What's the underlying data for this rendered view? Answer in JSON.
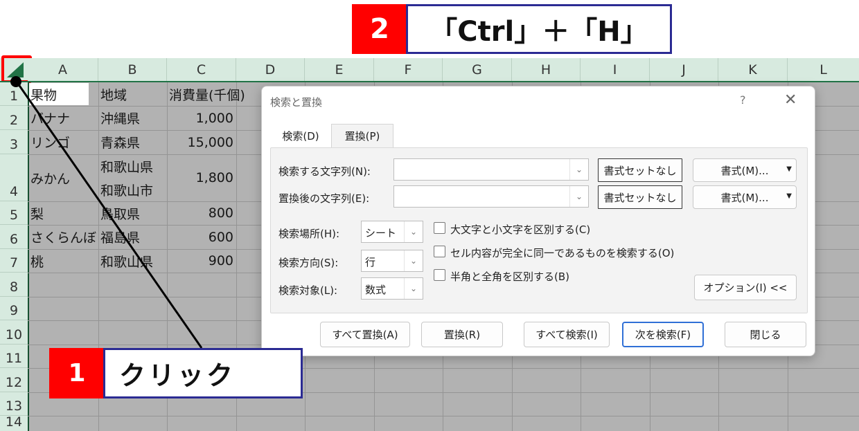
{
  "callout_top": {
    "number": "2",
    "text": "「Ctrl」＋「H」"
  },
  "callout_bottom": {
    "number": "1",
    "text": "クリック"
  },
  "columns": [
    "A",
    "B",
    "C",
    "D",
    "E",
    "F",
    "G",
    "H",
    "I",
    "J",
    "K",
    "L"
  ],
  "rows": [
    "1",
    "2",
    "3",
    "4",
    "5",
    "6",
    "7",
    "8",
    "9",
    "10",
    "11",
    "12",
    "13",
    "14"
  ],
  "cells": {
    "header": [
      "果物",
      "地域",
      "消費量(千個)"
    ],
    "r2": [
      "バナナ",
      "沖縄県",
      "1,000"
    ],
    "r3": [
      "リンゴ",
      "青森県",
      "15,000"
    ],
    "r4": [
      "みかん",
      "和歌山県",
      "和歌山市",
      "1,800"
    ],
    "r5": [
      "梨",
      "鳥取県",
      "800"
    ],
    "r6": [
      "さくらんぼ",
      "福島県",
      "600"
    ],
    "r7": [
      "桃",
      "和歌山県",
      "900"
    ]
  },
  "dialog": {
    "title": "検索と置換",
    "help": "?",
    "close": "✕",
    "tabs": [
      "検索(D)",
      "置換(P)"
    ],
    "find_label": "検索する文字列(N):",
    "find_value": "",
    "replace_label": "置換後の文字列(E):",
    "replace_value": "",
    "no_format": "書式セットなし",
    "format_btn": "書式(M)...",
    "within_label": "検索場所(H):",
    "within_value": "シート",
    "search_label": "検索方向(S):",
    "search_value": "行",
    "lookin_label": "検索対象(L):",
    "lookin_value": "数式",
    "match_case": "大文字と小文字を区別する(C)",
    "match_entire": "セル内容が完全に同一であるものを検索する(O)",
    "match_byte": "半角と全角を区別する(B)",
    "options_btn": "オプション(I) <<",
    "replace_all": "すべて置換(A)",
    "replace": "置換(R)",
    "find_all": "すべて検索(I)",
    "find_next": "次を検索(F)",
    "close_btn": "閉じる"
  },
  "colors": {
    "excel_green": "#217346",
    "header_bg": "#d7eadf",
    "callout_red": "#ff0000",
    "callout_border": "#2b2b93"
  }
}
